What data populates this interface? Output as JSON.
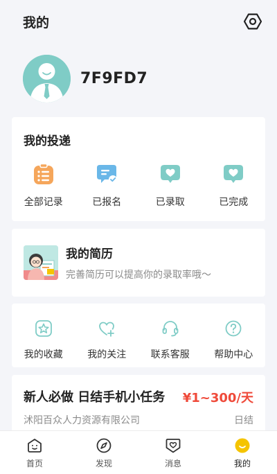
{
  "header": {
    "title": "我的"
  },
  "profile": {
    "username": "7F9FD7"
  },
  "deliveries": {
    "title": "我的投递",
    "items": [
      {
        "label": "全部记录",
        "icon": "clipboard-icon",
        "color": "#f5a65b"
      },
      {
        "label": "已报名",
        "icon": "message-check-icon",
        "color": "#6ab7e8"
      },
      {
        "label": "已录取",
        "icon": "heart-bubble-icon",
        "color": "#7fccc6"
      },
      {
        "label": "已完成",
        "icon": "heart-bubble-icon",
        "color": "#7fccc6"
      }
    ]
  },
  "resume": {
    "title": "我的简历",
    "subtitle": "完善简历可以提高你的录取率哦～"
  },
  "tools": {
    "items": [
      {
        "label": "我的收藏",
        "icon": "star-frame-icon"
      },
      {
        "label": "我的关注",
        "icon": "heart-plus-icon"
      },
      {
        "label": "联系客服",
        "icon": "headset-icon"
      },
      {
        "label": "帮助中心",
        "icon": "question-icon"
      }
    ],
    "color": "#7fccc6"
  },
  "job": {
    "title": "新人必做 日结手机小任务",
    "salary": "¥1~300/天",
    "company": "沭阳百众人力资源有限公司",
    "settlement": "日结"
  },
  "tabbar": {
    "items": [
      {
        "label": "首页",
        "icon": "home-face-icon"
      },
      {
        "label": "发现",
        "icon": "compass-icon"
      },
      {
        "label": "消息",
        "icon": "message-heart-icon"
      },
      {
        "label": "我的",
        "icon": "profile-smile-icon",
        "active": true
      }
    ],
    "active_color": "#f5c400"
  },
  "colors": {
    "accent": "#7fccc6",
    "salary": "#ef4a3a",
    "background": "#f4f5f9"
  }
}
